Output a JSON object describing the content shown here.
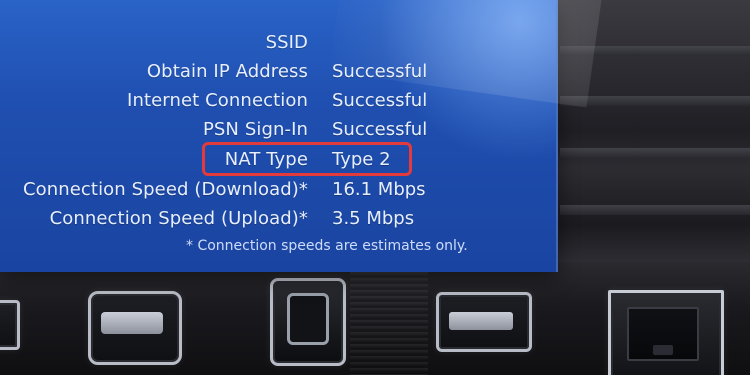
{
  "network_test": {
    "rows": [
      {
        "label": "SSID",
        "value": ""
      },
      {
        "label": "Obtain IP Address",
        "value": "Successful"
      },
      {
        "label": "Internet Connection",
        "value": "Successful"
      },
      {
        "label": "PSN Sign-In",
        "value": "Successful"
      },
      {
        "label": "NAT Type",
        "value": "Type 2"
      },
      {
        "label": "Connection Speed (Download)*",
        "value": "16.1 Mbps"
      },
      {
        "label": "Connection Speed (Upload)*",
        "value": "3.5 Mbps"
      }
    ],
    "note": "* Connection speeds are estimates only."
  },
  "colors": {
    "panel_blue": "#1f4fb0",
    "text": "#e7efff",
    "highlight_red": "#e33b3b"
  },
  "icons": {
    "usb": "usb-port-icon",
    "optical": "optical-audio-port-icon",
    "ethernet": "ethernet-port-icon"
  }
}
